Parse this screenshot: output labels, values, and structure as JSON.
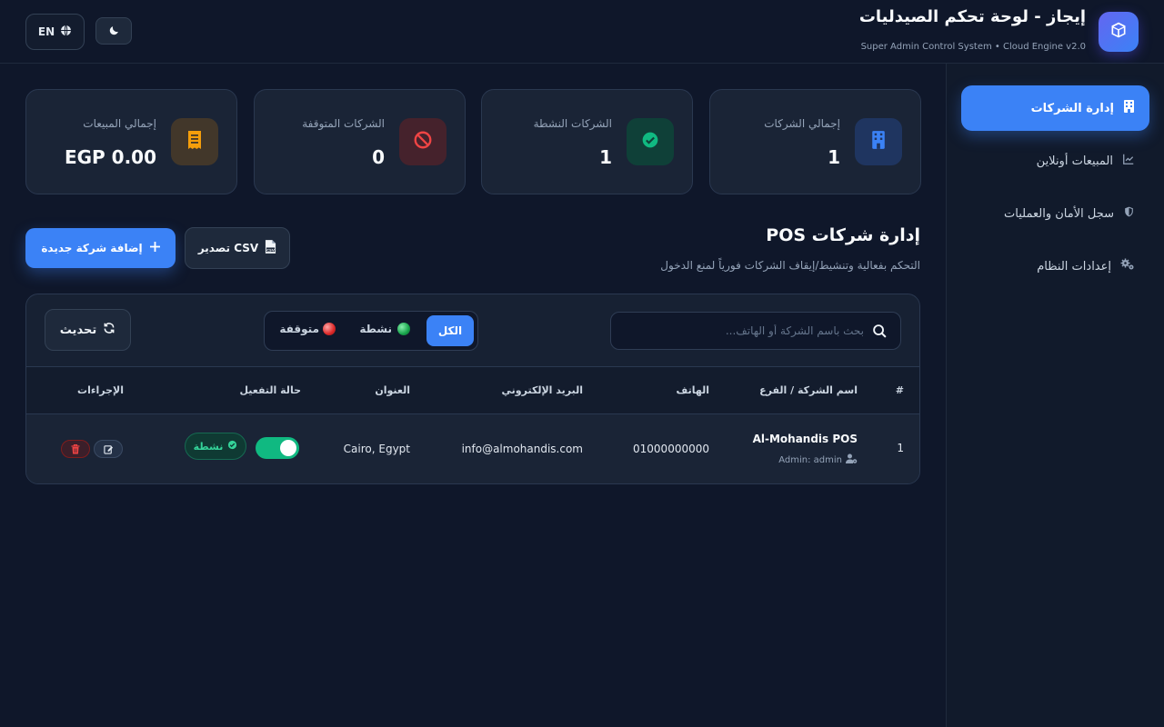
{
  "header": {
    "title": "إيجاز - لوحة تحكم الصيدليات",
    "subtitle": "Super Admin Control System • Cloud Engine v2.0",
    "lang_label": "EN",
    "logo_icon": "box-icon"
  },
  "sidebar": {
    "items": [
      {
        "label": "إدارة الشركات",
        "icon": "building-icon",
        "active": true
      },
      {
        "label": "المبيعات أونلاين",
        "icon": "chart-line-icon",
        "active": false
      },
      {
        "label": "سجل الأمان والعمليات",
        "icon": "shield-icon",
        "active": false
      },
      {
        "label": "إعدادات النظام",
        "icon": "gears-icon",
        "active": false
      }
    ]
  },
  "stats": {
    "total_companies": {
      "label": "إجمالي الشركات",
      "value": "1",
      "color": "#3b82f6"
    },
    "active_companies": {
      "label": "الشركات النشطة",
      "value": "1",
      "color": "#10b981"
    },
    "stopped_companies": {
      "label": "الشركات المتوقفة",
      "value": "0",
      "color": "#ef4444"
    },
    "total_sales": {
      "label": "إجمالي المبيعات",
      "value": "EGP 0.00",
      "color": "#f59e0b"
    }
  },
  "section": {
    "title": "إدارة شركات POS",
    "subtitle": "التحكم بفعالية وتنشيط/إيقاف الشركات فورياً لمنع الدخول",
    "add_button": "إضافة شركة جديدة",
    "export_button": "تصدير CSV"
  },
  "toolbar": {
    "search_placeholder": "بحث باسم الشركة أو الهاتف...",
    "filter_all": "الكل",
    "filter_active": "نشطة",
    "filter_stopped": "متوقفة",
    "refresh_button": "تحديث"
  },
  "table": {
    "columns": {
      "index": "#",
      "name": "اسم الشركة / الفرع",
      "phone": "الهاتف",
      "email": "البريد الإلكتروني",
      "address": "العنوان",
      "status": "حالة التفعيل",
      "actions": "الإجراءات"
    },
    "rows": [
      {
        "index": "1",
        "name": "Al-Mohandis POS",
        "admin": "Admin: admin",
        "phone": "01000000000",
        "email": "info@almohandis.com",
        "address": "Cairo, Egypt",
        "status": "نشطة",
        "enabled": true
      }
    ]
  }
}
